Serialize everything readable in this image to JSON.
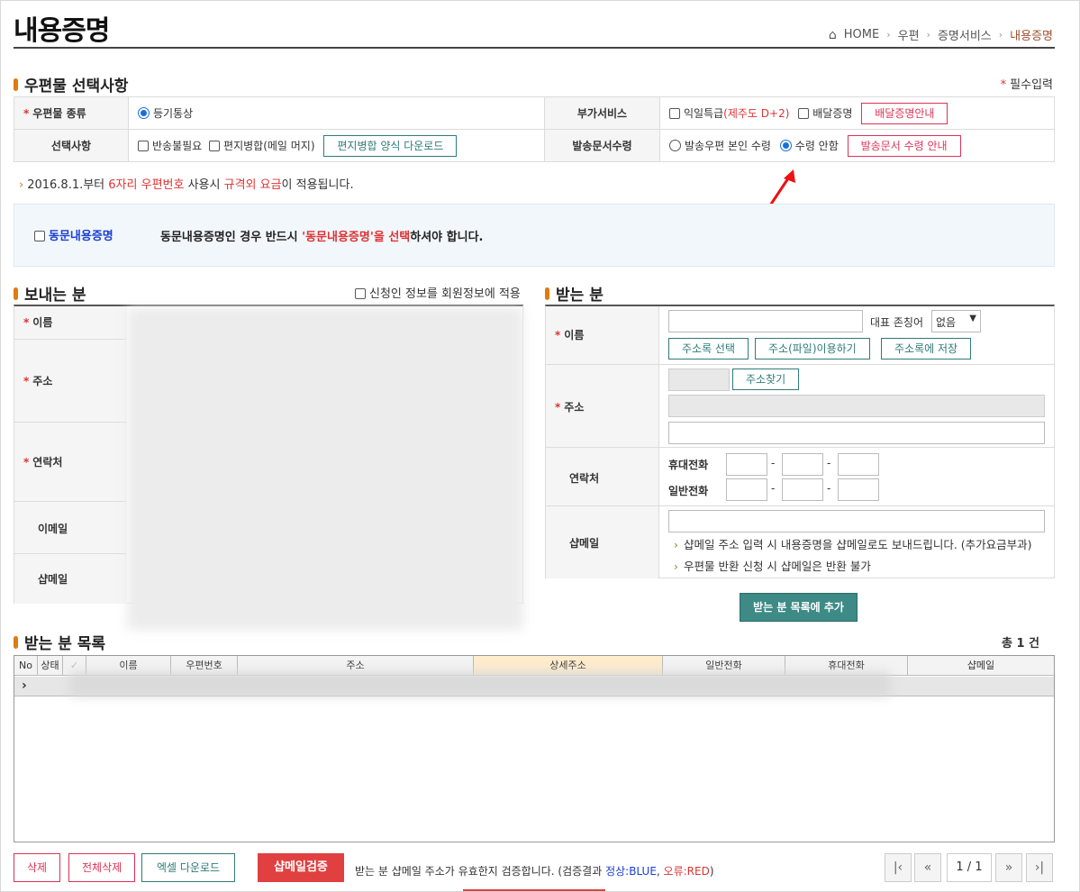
{
  "page": {
    "title": "내용증명"
  },
  "breadcrumb": [
    "HOME",
    "우편",
    "증명서비스",
    "내용증명"
  ],
  "options": {
    "section_title": "우편물 선택사항",
    "required_note": "필수입력",
    "mail_type_label": "우편물 종류",
    "mail_type_value": "등기통상",
    "extra_service_label": "부가서비스",
    "extra_next_day": "익일특급",
    "extra_next_day_note": "(제주도 D+2)",
    "extra_delivery_proof": "배달증명",
    "delivery_proof_guide_btn": "배달증명안내",
    "selection_label": "선택사항",
    "no_return": "반송불필요",
    "letter_merge": "편지병합(메일 머지)",
    "merge_download_btn": "편지병합 양식 다운로드",
    "doc_receive_label": "발송문서수령",
    "receive_self": "발송우편 본인 수령",
    "receive_none": "수령 안함",
    "receive_guide_btn": "발송문서 수령 안내"
  },
  "notice": {
    "prefix": "2016.8.1.부터 ",
    "red1": "6자리 우편번호",
    "mid": " 사용시 ",
    "red2": "규격외 요금",
    "suffix": "이 적용됩니다."
  },
  "joint": {
    "checkbox_label": "동문내용증명",
    "msg_prefix": "동문내용증명인 경우 반드시 ",
    "msg_red": "'동문내용증명'을 선택",
    "msg_suffix": "하셔야 합니다."
  },
  "sender": {
    "title": "보내는 분",
    "apply_member": "신청인 정보를 회원정보에 적용",
    "name_label": "이름",
    "address_label": "주소",
    "contact_label": "연락처",
    "email_label": "이메일",
    "shopmail_label": "샵메일"
  },
  "receiver": {
    "title": "받는 분",
    "name_label": "이름",
    "rep_title_label": "대표 존칭어",
    "rep_title_value": "없음",
    "addrbook_select_btn": "주소록 선택",
    "addr_file_btn": "주소(파일)이용하기",
    "save_addrbook_btn": "주소록에 저장",
    "address_label": "주소",
    "find_address_btn": "주소찾기",
    "contact_label": "연락처",
    "mobile_label": "휴대전화",
    "phone_label": "일반전화",
    "shopmail_label": "샵메일",
    "shopmail_note1": "샵메일 주소 입력 시 내용증명을 샵메일로도 보내드립니다. (추가요금부과)",
    "shopmail_note2": "우편물 반환 신청 시 샵메일은 반환 불가",
    "add_btn": "받는 분 목록에 추가"
  },
  "list": {
    "title": "받는 분 목록",
    "total": "총 1 건",
    "columns": [
      "No",
      "상태",
      "✓",
      "이름",
      "우편번호",
      "주소",
      "상세주소",
      "일반전화",
      "휴대전화",
      "샵메일"
    ]
  },
  "footer": {
    "delete_btn": "삭제",
    "delete_all_btn": "전체삭제",
    "excel_btn": "엑셀 다운로드",
    "verify_btn": "샵메일검증",
    "verify_msg_prefix": "받는 분 샵메일 주소가 유효한지 검증합니다. (검증결과 ",
    "verify_blue": "정상:BLUE",
    "verify_sep": ", ",
    "verify_red": "오류:RED",
    "verify_suffix": ")",
    "page_indicator": "1 / 1"
  },
  "colors": {
    "accent": "#e07b0f",
    "teal": "#2f7a7a",
    "red": "#d33",
    "blue_link": "#1a3fd0"
  }
}
